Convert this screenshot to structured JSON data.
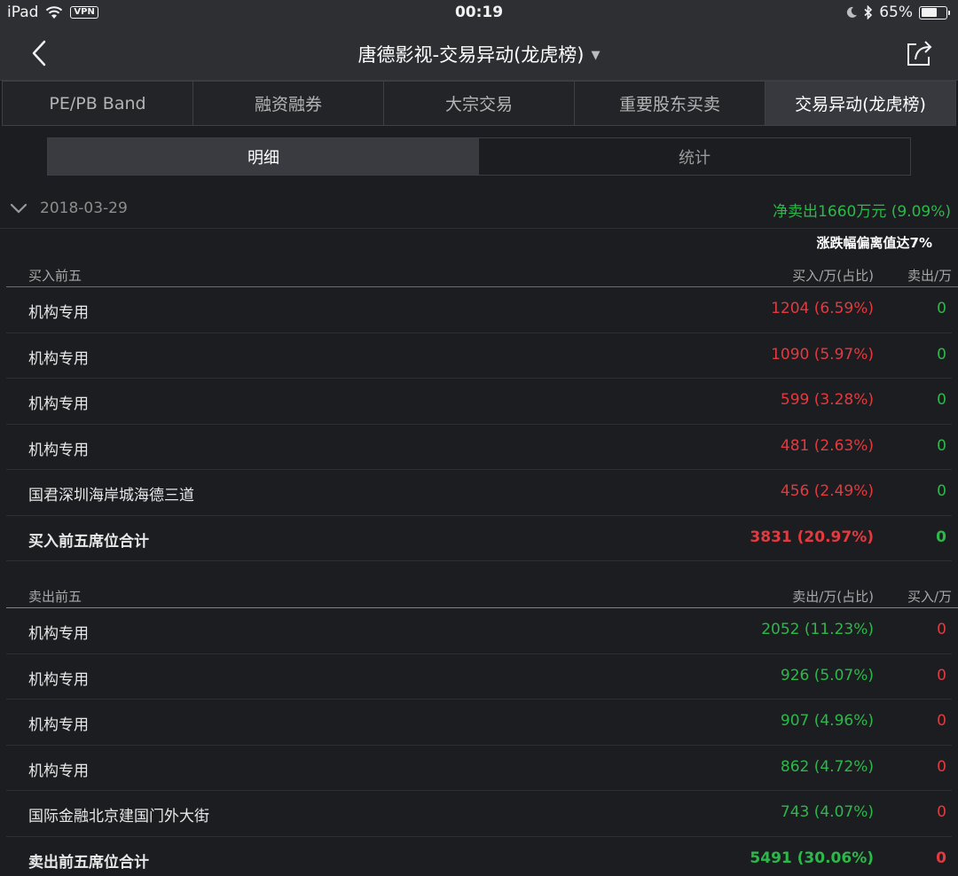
{
  "status": {
    "device": "iPad",
    "vpn": "VPN",
    "time": "00:19",
    "battery": "65%",
    "battery_level": 0.65
  },
  "nav": {
    "title": "唐德影视-交易异动(龙虎榜)",
    "caret": "▼"
  },
  "tabs": [
    "PE/PB Band",
    "融资融券",
    "大宗交易",
    "重要股东买卖",
    "交易异动(龙虎榜)"
  ],
  "segments": [
    "明细",
    "统计"
  ],
  "record": {
    "date": "2018-03-29",
    "net": "净卖出1660万元 (9.09%)",
    "reason": "涨跌幅偏离值达7%"
  },
  "buy_section": {
    "title": "买入前五",
    "col_main": "买入/万(占比)",
    "col_other": "卖出/万",
    "rows": [
      {
        "name": "机构专用",
        "value": "1204 (6.59%)",
        "other": "0"
      },
      {
        "name": "机构专用",
        "value": "1090 (5.97%)",
        "other": "0"
      },
      {
        "name": "机构专用",
        "value": "599 (3.28%)",
        "other": "0"
      },
      {
        "name": "机构专用",
        "value": "481 (2.63%)",
        "other": "0"
      },
      {
        "name": "国君深圳海岸城海德三道",
        "value": "456 (2.49%)",
        "other": "0"
      }
    ],
    "total": {
      "name": "买入前五席位合计",
      "value": "3831 (20.97%)",
      "other": "0"
    }
  },
  "sell_section": {
    "title": "卖出前五",
    "col_main": "卖出/万(占比)",
    "col_other": "买入/万",
    "rows": [
      {
        "name": "机构专用",
        "value": "2052 (11.23%)",
        "other": "0"
      },
      {
        "name": "机构专用",
        "value": "926 (5.07%)",
        "other": "0"
      },
      {
        "name": "机构专用",
        "value": "907 (4.96%)",
        "other": "0"
      },
      {
        "name": "机构专用",
        "value": "862 (4.72%)",
        "other": "0"
      },
      {
        "name": "国际金融北京建国门外大街",
        "value": "743 (4.07%)",
        "other": "0"
      }
    ],
    "total": {
      "name": "卖出前五席位合计",
      "value": "5491 (30.06%)",
      "other": "0"
    }
  },
  "colors": {
    "background": "#1c1d21",
    "bar": "#2e2f33",
    "buy_red": "#e23a3f",
    "sell_green": "#2db84a"
  }
}
